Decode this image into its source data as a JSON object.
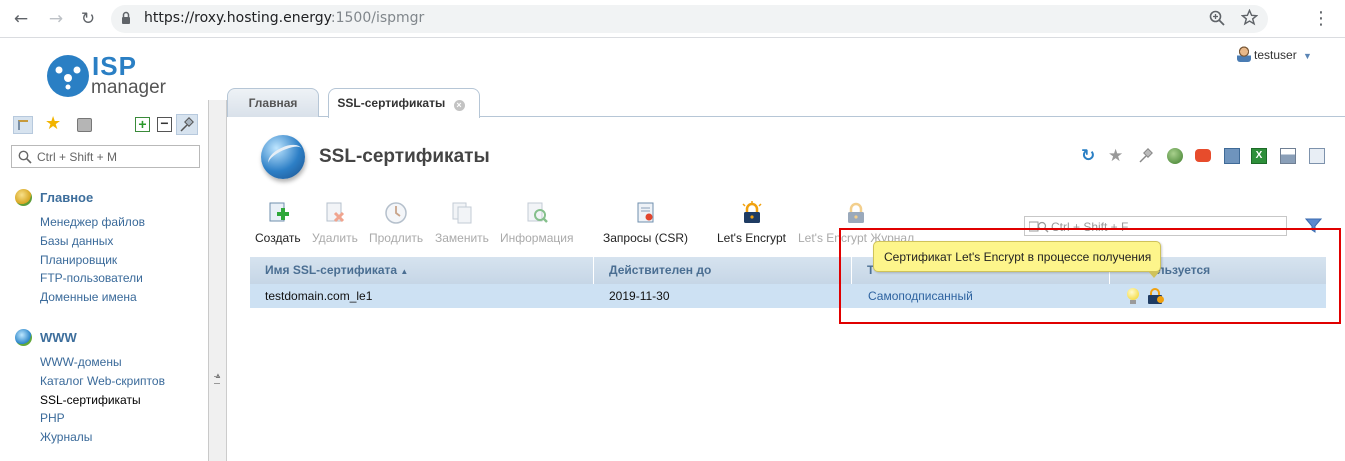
{
  "browser": {
    "url_main": "https://roxy.hosting.energy",
    "url_rest": ":1500/ispmgr"
  },
  "header": {
    "logo_isp": "ISP",
    "logo_manager": "manager",
    "user": "testuser"
  },
  "left": {
    "search_placeholder": "Ctrl + Shift + M",
    "sections": [
      {
        "title": "Главное",
        "items": [
          "Менеджер файлов",
          "Базы данных",
          "Планировщик",
          "FTP-пользователи",
          "Доменные имена"
        ]
      },
      {
        "title": "WWW",
        "items": [
          "WWW-домены",
          "Каталог Web-скриптов",
          "SSL-сертификаты",
          "PHP",
          "Журналы"
        ]
      }
    ]
  },
  "tabs": [
    "Главная",
    "SSL-сертификаты"
  ],
  "main": {
    "title": "SSL-сертификаты",
    "toolbar": {
      "create": "Создать",
      "delete": "Удалить",
      "renew": "Продлить",
      "replace": "Заменить",
      "info": "Информация",
      "csr": "Запросы (CSR)",
      "letsencrypt": "Let's Encrypt",
      "le_journal": "Let's Encrypt Журнал"
    },
    "filter_placeholder": "Ctrl + Shift + F",
    "table": {
      "headers": [
        "Имя SSL-сертификата",
        "Действителен до",
        "Т",
        "ользуется"
      ],
      "rows": [
        {
          "name": "testdomain.com_le1",
          "valid_until": "2019-11-30",
          "type": "Самоподписанный"
        }
      ]
    },
    "tooltip": "Сертификат Let's Encrypt в процессе получения"
  },
  "colors": {
    "accent": "#3d6e9c",
    "highlight_border": "#e00000",
    "tooltip_bg": "#fdf58b"
  }
}
